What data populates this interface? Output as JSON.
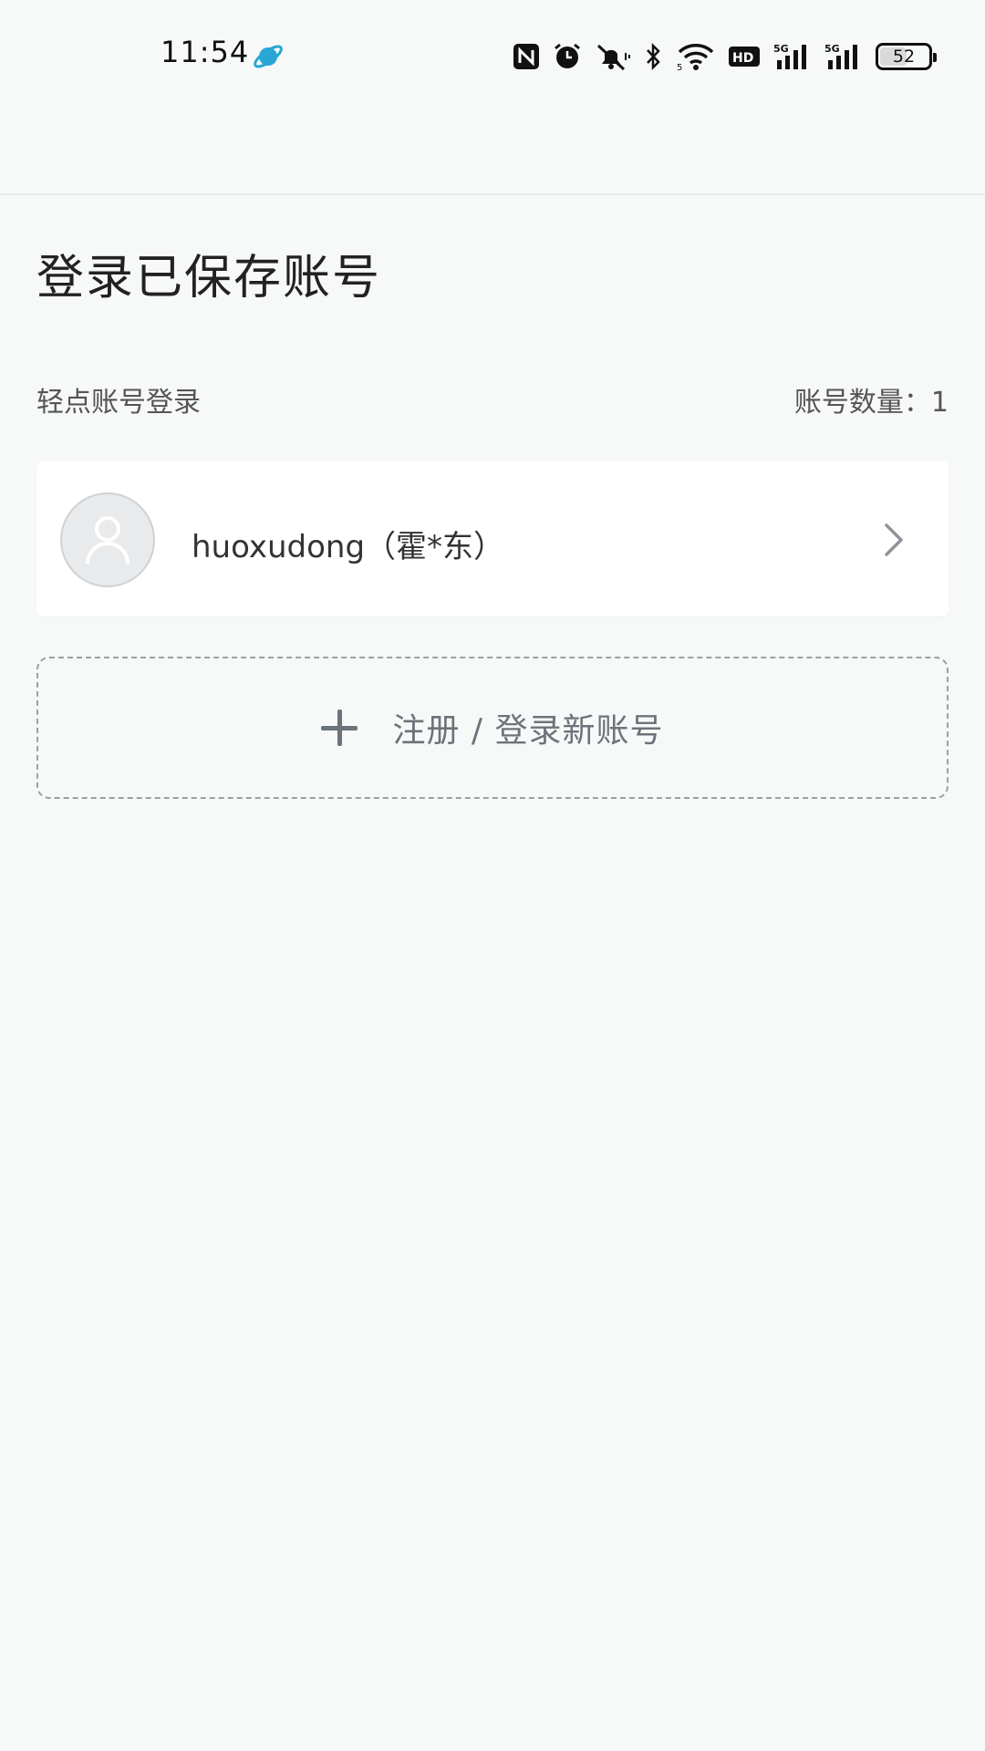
{
  "status_bar": {
    "time": "11:54",
    "network_left": "5G",
    "network_right": "5G",
    "hd_label": "HD",
    "battery": "52",
    "battery_level": 0.52,
    "icons": [
      "planet-icon",
      "nfc-icon",
      "alarm-icon",
      "mute-icon",
      "bluetooth-icon",
      "wifi-icon",
      "hd-icon",
      "signal-icon",
      "signal-icon",
      "battery-icon"
    ]
  },
  "page": {
    "title": "登录已保存账号",
    "hint": "轻点账号登录",
    "count_label": "账号数量：1"
  },
  "accounts": [
    {
      "name": "huoxudong（霍*东）"
    }
  ],
  "add_account": {
    "label": "注册 / 登录新账号"
  },
  "colors": {
    "background": "#f7f9f9",
    "card": "#ffffff",
    "muted": "#6c737a",
    "accent_planet": "#2aa6d6"
  }
}
